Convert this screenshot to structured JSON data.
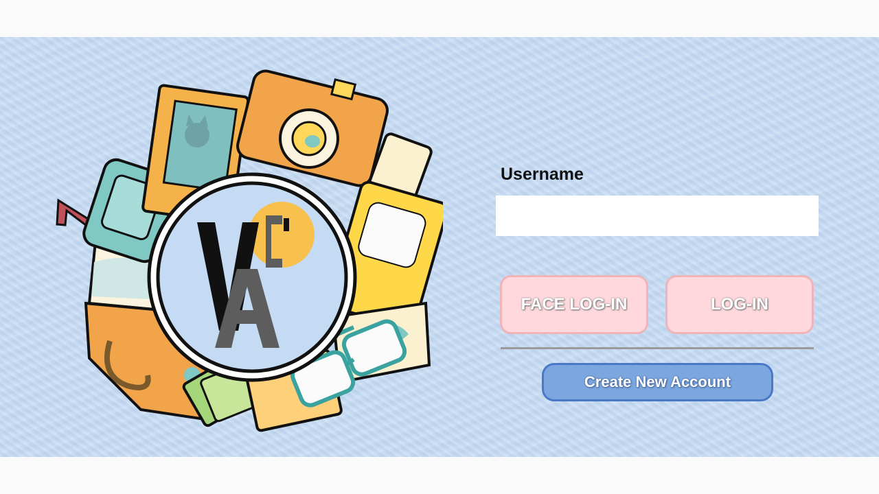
{
  "logo": {
    "letters": "VCA"
  },
  "form": {
    "username_label": "Username",
    "username_value": "",
    "username_placeholder": "",
    "face_login_label": "FACE LOG-IN",
    "login_label": "LOG-IN",
    "create_account_label": "Create New Account"
  },
  "colors": {
    "background": "#c8dcf3",
    "pink_button": "#fed8dc",
    "pink_border": "#efb3b8",
    "create_button": "#7ba6de",
    "create_border": "#4a78c8"
  }
}
